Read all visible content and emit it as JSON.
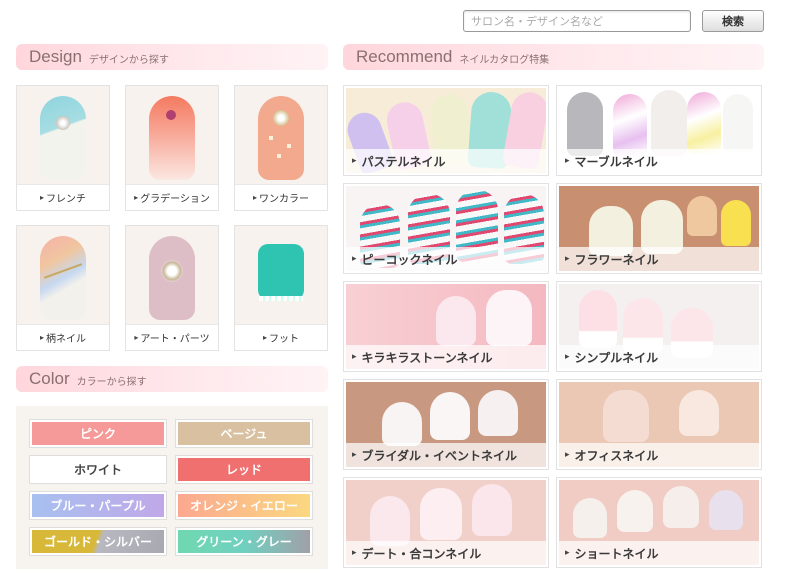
{
  "search": {
    "placeholder": "サロン名・デザイン名など",
    "button_label": "検索"
  },
  "design": {
    "title": "Design",
    "subtitle": "デザインから探す",
    "items": [
      {
        "label": "フレンチ"
      },
      {
        "label": "グラデーション"
      },
      {
        "label": "ワンカラー"
      },
      {
        "label": "柄ネイル"
      },
      {
        "label": "アート・パーツ"
      },
      {
        "label": "フット"
      }
    ]
  },
  "color": {
    "title": "Color",
    "subtitle": "カラーから探す",
    "items": [
      {
        "label": "ピンク"
      },
      {
        "label": "ベージュ"
      },
      {
        "label": "ホワイト"
      },
      {
        "label": "レッド"
      },
      {
        "label": "ブルー・パープル"
      },
      {
        "label": "オレンジ・イエロー"
      },
      {
        "label": "ゴールド・シルバー"
      },
      {
        "label": "グリーン・グレー"
      }
    ]
  },
  "recommend": {
    "title": "Recommend",
    "subtitle": "ネイルカタログ特集",
    "items": [
      {
        "label": "パステルネイル"
      },
      {
        "label": "マーブルネイル"
      },
      {
        "label": "ピーコックネイル"
      },
      {
        "label": "フラワーネイル"
      },
      {
        "label": "キラキラストーンネイル"
      },
      {
        "label": "シンプルネイル"
      },
      {
        "label": "ブライダル・イベントネイル"
      },
      {
        "label": "オフィスネイル"
      },
      {
        "label": "デート・合コンネイル"
      },
      {
        "label": "ショートネイル"
      }
    ]
  },
  "colors": {
    "pink": "#f59a98",
    "beige": "#d8c0a0",
    "white": "#ffffff",
    "red": "#f07070",
    "blue_purple": "#b8a8e8",
    "orange_yellow": "#fbc090",
    "gold_silver": "#d8c050",
    "green_gray": "#80d8b8",
    "header_pink": "#ffd6dc"
  }
}
